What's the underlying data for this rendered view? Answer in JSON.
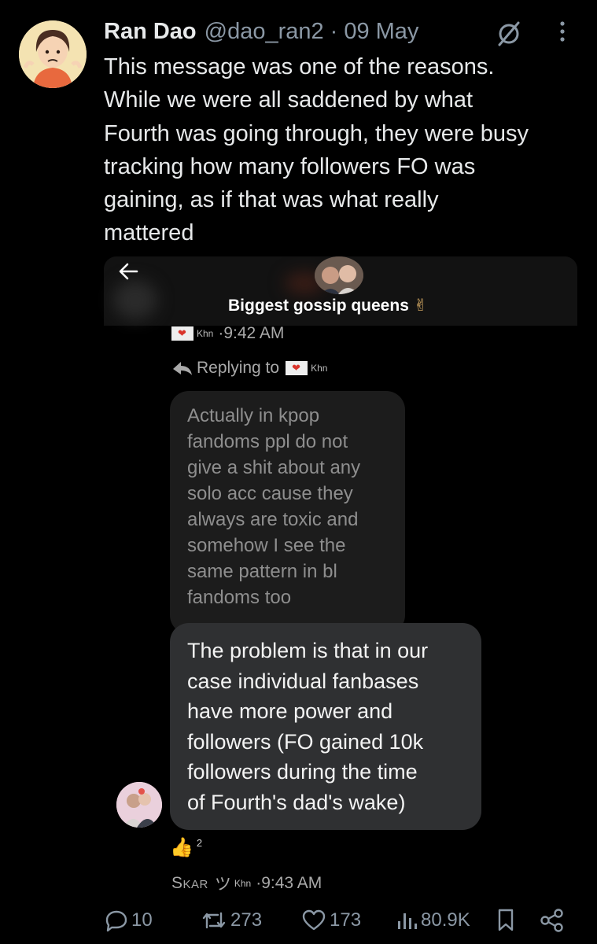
{
  "tweet": {
    "author_name": "Ran Dao",
    "author_handle": "@dao_ran2",
    "separator": "·",
    "date": "09 May",
    "text": "This message was one of the reasons.\nWhile we were all saddened by what\nFourth was going through, they were busy\ntracking how many followers FO was\ngaining, as if that was what really\nmattered"
  },
  "screenshot": {
    "group_name": "Biggest gossip queens",
    "group_emoji": "✌",
    "first_message_user": "Khn",
    "first_message_time": "·9:42 AM",
    "replying_label": "Replying to",
    "replying_user": "Khn",
    "quoted_message": "Actually in kpop\nfandoms ppl do not\ngive a shit about any\nsolo acc cause they\nalways are toxic and\nsomehow I see the\nsame pattern in bl\nfandoms too",
    "reply_message": "The problem is that in our\ncase individual fanbases\nhave more power and\nfollowers (FO gained 10k\nfollowers during the time\nof Fourth's dad's wake)",
    "reaction_emoji": "👍",
    "reaction_count": "2",
    "sender_name": "Skar",
    "sender_symbol": "ツ",
    "sender_tag": "Khn",
    "sender_time": "·9:43 AM"
  },
  "actions": {
    "replies": "10",
    "reposts": "273",
    "likes": "173",
    "views": "80.9K"
  },
  "icons": [
    "grok-icon",
    "more-icon",
    "back-arrow-icon",
    "reply-arrow-icon",
    "reply-icon",
    "repost-icon",
    "like-icon",
    "views-icon",
    "bookmark-icon",
    "share-icon"
  ],
  "colors": {
    "background": "#000000",
    "text": "#e7e9ea",
    "muted": "#8b98a5",
    "bubble_dark": "#2f3032",
    "bubble_gray": "#1c1c1c"
  }
}
